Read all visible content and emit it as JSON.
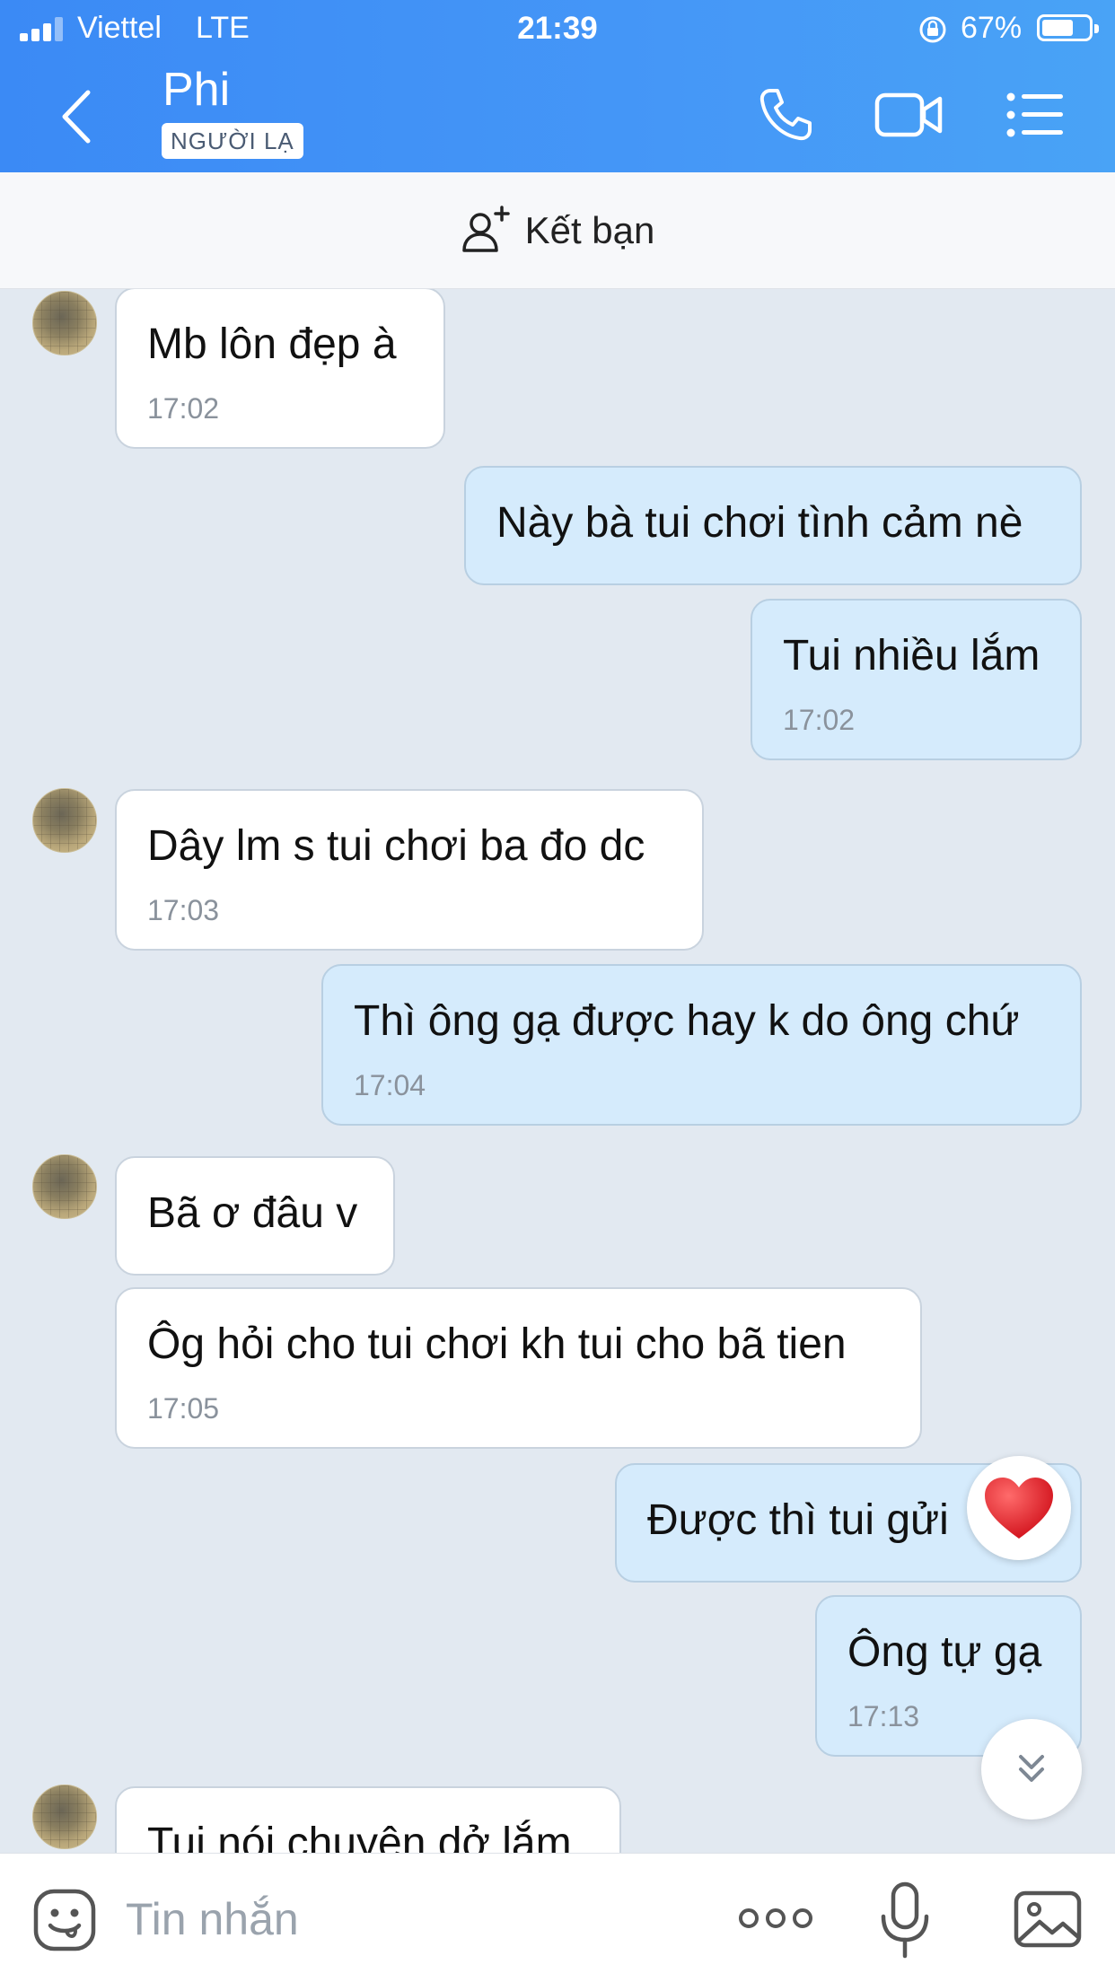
{
  "status_bar": {
    "carrier": "Viettel",
    "network": "LTE",
    "time": "21:39",
    "battery": "67%",
    "battery_level": 0.67
  },
  "header": {
    "contact_name": "Phi",
    "badge": "NGƯỜI LẠ",
    "icons": [
      "back-icon",
      "phone-icon",
      "video-call-icon",
      "menu-icon"
    ]
  },
  "add_friend": {
    "label": "Kết bạn",
    "icon": "add-friend-icon"
  },
  "messages": [
    {
      "side": "in",
      "text": "Mb lôn đẹp à",
      "time": "17:02"
    },
    {
      "side": "out",
      "text": "Này bà tui chơi tình cảm nè",
      "time": ""
    },
    {
      "side": "out",
      "text": "Tui nhiều lắm",
      "time": "17:02"
    },
    {
      "side": "in",
      "text": "Dây lm s tui chơi ba đo dc",
      "time": "17:03"
    },
    {
      "side": "out",
      "text": "Thì ông gạ được hay k do ông chứ",
      "time": "17:04"
    },
    {
      "side": "in",
      "text": "Bã ơ đâu v",
      "time": ""
    },
    {
      "side": "in",
      "text": "Ôg hỏi cho tui chơi kh tui cho bã tien",
      "time": "17:05"
    },
    {
      "side": "out",
      "text": "Được thì tui gửi",
      "time": "",
      "reaction": "heart-icon"
    },
    {
      "side": "out",
      "text": "Ông tự gạ",
      "time": "17:13"
    },
    {
      "side": "in",
      "text": "Tui nói chuyện dở lắm",
      "time": ""
    }
  ],
  "input_bar": {
    "placeholder": "Tin nhắn",
    "icons": [
      "emoji-icon",
      "more-icon",
      "microphone-icon",
      "image-icon"
    ]
  },
  "colors": {
    "header": "#3b8af5",
    "incoming_bubble": "#ffffff",
    "outgoing_bubble": "#d5ebfc",
    "chat_background": "#e2e9f1"
  }
}
